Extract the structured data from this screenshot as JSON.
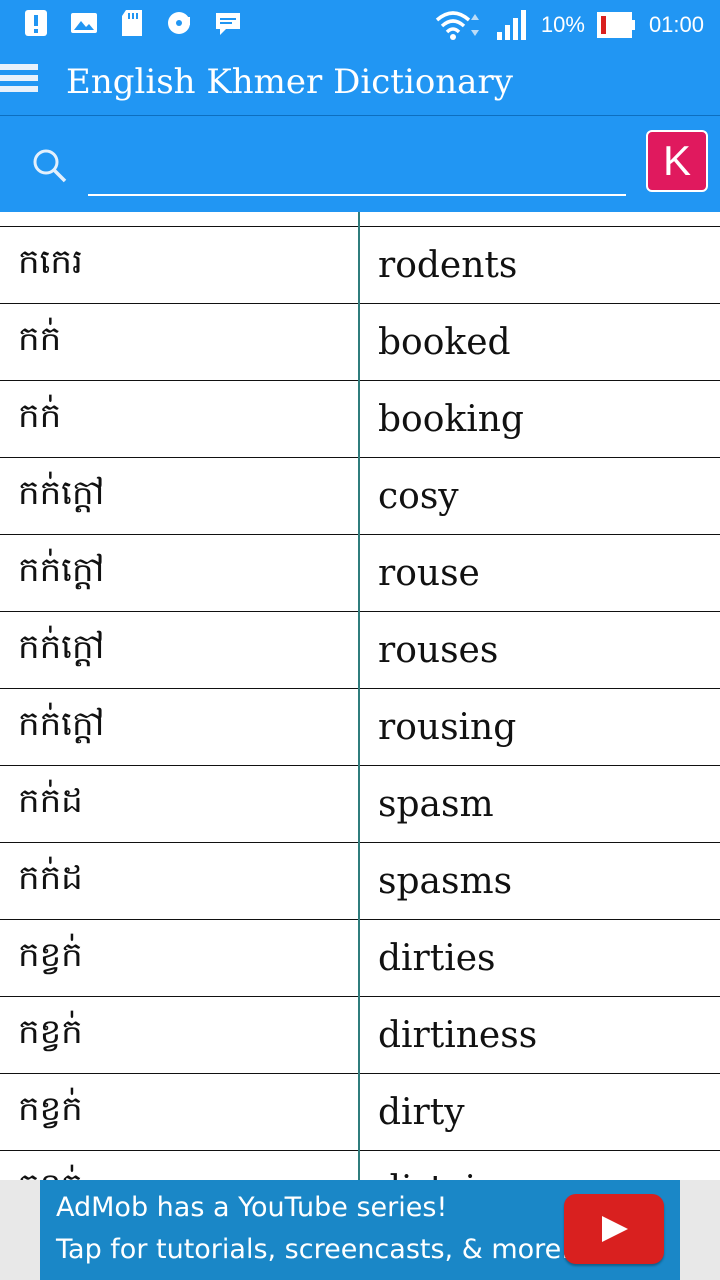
{
  "status_bar": {
    "left_icons": [
      "alert-icon",
      "image-icon",
      "sd-card-icon",
      "media-icon",
      "message-icon"
    ],
    "battery_percent": "10%",
    "time": "01:00"
  },
  "app_bar": {
    "title": "English Khmer Dictionary"
  },
  "search": {
    "value": "",
    "placeholder": "",
    "keyboard_button_label": "K"
  },
  "rows": [
    {
      "khmer": "កកេរ",
      "english": "rodents"
    },
    {
      "khmer": "កក់",
      "english": "booked"
    },
    {
      "khmer": "កក់",
      "english": "booking"
    },
    {
      "khmer": "កក់ក្ដៅ",
      "english": "cosy"
    },
    {
      "khmer": "កក់ក្ដៅ",
      "english": "rouse"
    },
    {
      "khmer": "កក់ក្ដៅ",
      "english": "rouses"
    },
    {
      "khmer": "កក់ក្ដៅ",
      "english": "rousing"
    },
    {
      "khmer": "កក់ដ",
      "english": "spasm"
    },
    {
      "khmer": "កក់ដ",
      "english": "spasms"
    },
    {
      "khmer": "កខ្វក់",
      "english": "dirties"
    },
    {
      "khmer": "កខ្វក់",
      "english": "dirtiness"
    },
    {
      "khmer": "កខ្វក់",
      "english": "dirty"
    },
    {
      "khmer": "កខ្វក់",
      "english": "dirtying"
    }
  ],
  "ad": {
    "line1": "AdMob has a YouTube series!",
    "line2": "Tap for tutorials, screencasts, & more."
  },
  "colors": {
    "primary": "#2196F3",
    "accent": "#E0195E",
    "ad_background": "#1a87c7",
    "youtube_red": "#d9201f"
  }
}
